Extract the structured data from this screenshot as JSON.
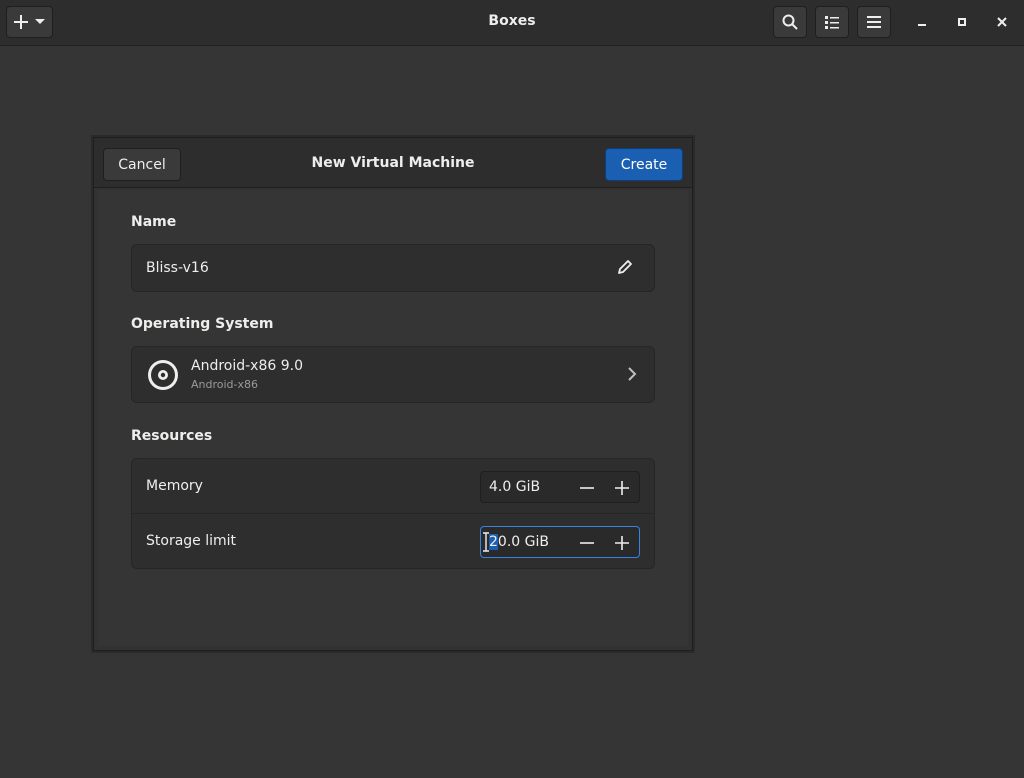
{
  "app": {
    "title": "Boxes"
  },
  "headerbar": {
    "icons": [
      "add-icon",
      "dropdown-icon",
      "search-icon",
      "list-view-icon",
      "menu-icon",
      "minimize-icon",
      "maximize-icon",
      "close-icon"
    ]
  },
  "dialog": {
    "title": "New Virtual Machine",
    "cancel_label": "Cancel",
    "create_label": "Create",
    "accent": "#1b5fb3",
    "name_section": {
      "label": "Name",
      "value": "Bliss-v16"
    },
    "os_section": {
      "label": "Operating System",
      "name": "Android-x86 9.0",
      "subtitle": "Android-x86"
    },
    "resources_section": {
      "label": "Resources",
      "memory": {
        "label": "Memory",
        "value": "4.0 GiB"
      },
      "storage": {
        "label": "Storage limit",
        "value_selected": "2",
        "value_rest": "0.0 GiB"
      }
    }
  }
}
